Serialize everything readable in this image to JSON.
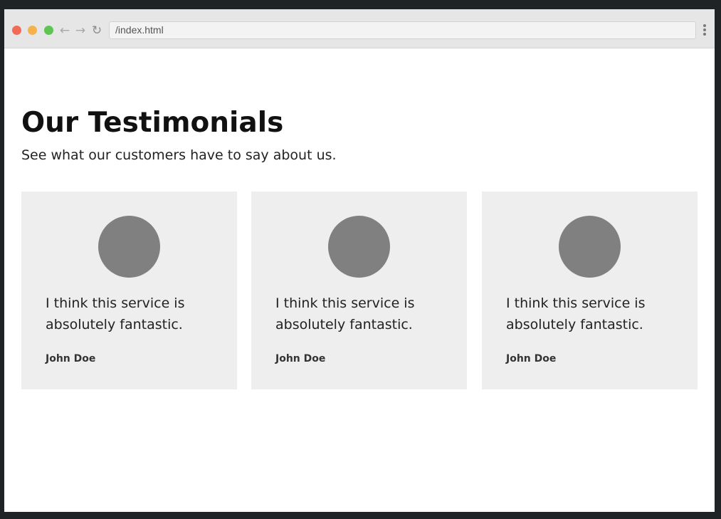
{
  "browser": {
    "url": "/index.html",
    "back_icon": "←",
    "forward_icon": "→",
    "reload_icon": "↻"
  },
  "page": {
    "title": "Our Testimonials",
    "subtitle": "See what our customers have to say about us."
  },
  "testimonials": [
    {
      "quote": "I think this service is absolutely fantastic.",
      "author": "John Doe"
    },
    {
      "quote": "I think this service is absolutely fantastic.",
      "author": "John Doe"
    },
    {
      "quote": "I think this service is absolutely fantastic.",
      "author": "John Doe"
    }
  ],
  "colors": {
    "card_background": "#eeeeee",
    "avatar_placeholder": "#808080",
    "close_dot": "#f46a59",
    "minimize_dot": "#f6b24a",
    "maximize_dot": "#5fc453"
  }
}
